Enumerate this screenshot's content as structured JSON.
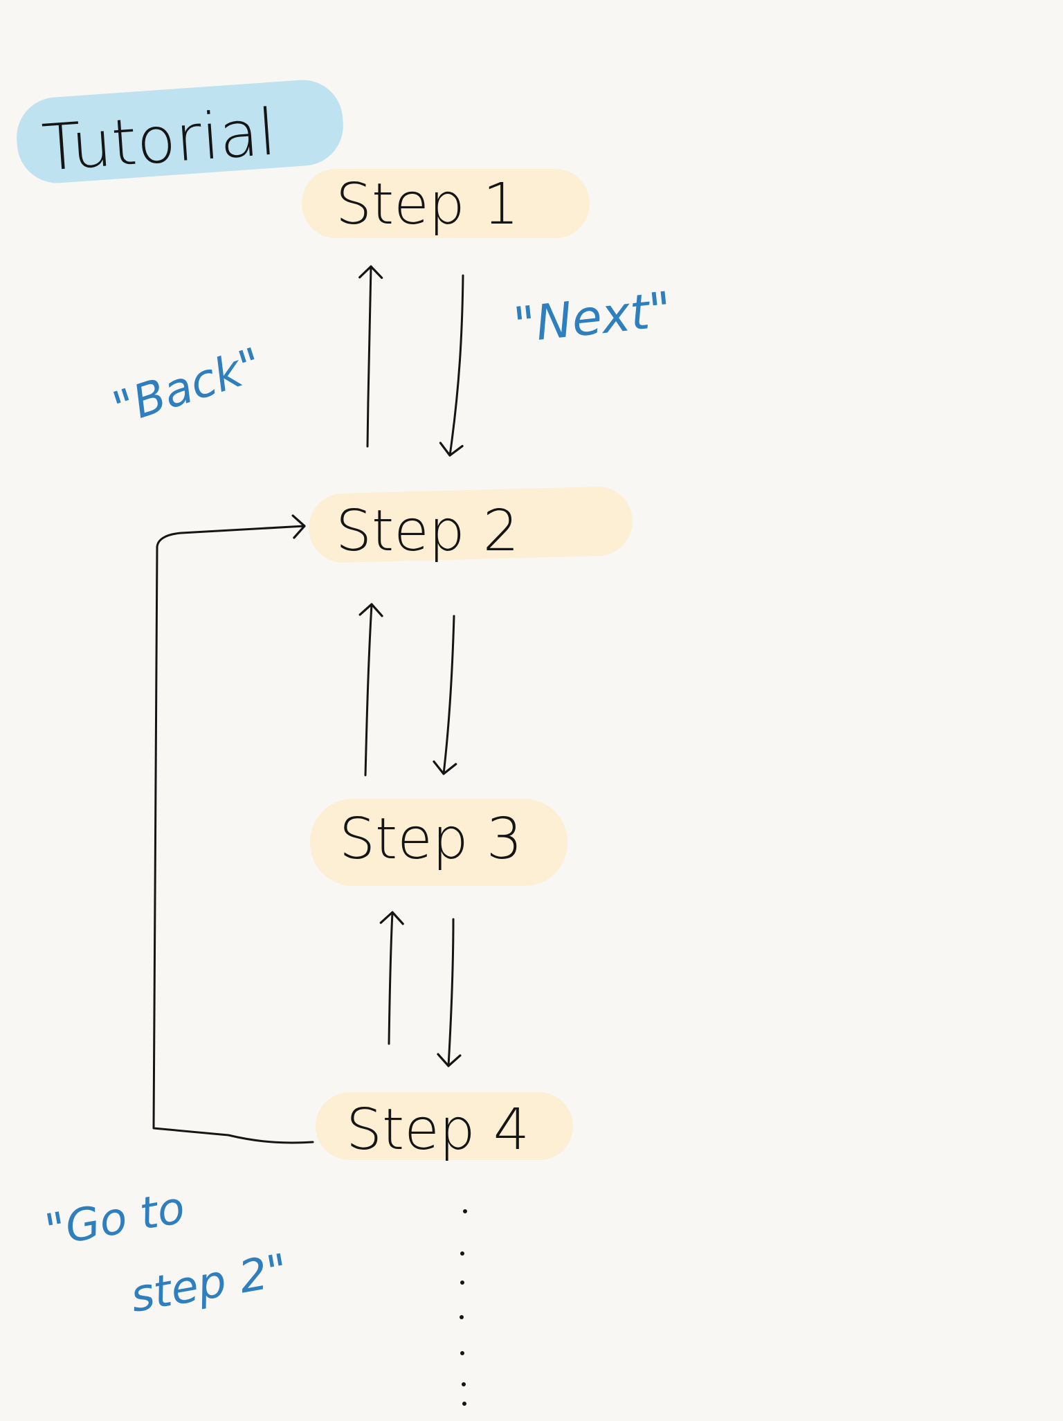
{
  "title": "Tutorial",
  "steps": [
    "Step 1",
    "Step 2",
    "Step 3",
    "Step 4"
  ],
  "annotations": {
    "back": "\"Back\"",
    "next": "\"Next\"",
    "goto_line1": "\"Go to",
    "goto_line2": "step 2\""
  },
  "continuation_marker": "...",
  "colors": {
    "background": "#f8f7f4",
    "title_highlight": "#bfe2f1",
    "step_highlight": "#fcefd4",
    "ink": "#151515",
    "annotation_ink": "#2f7fbf"
  }
}
